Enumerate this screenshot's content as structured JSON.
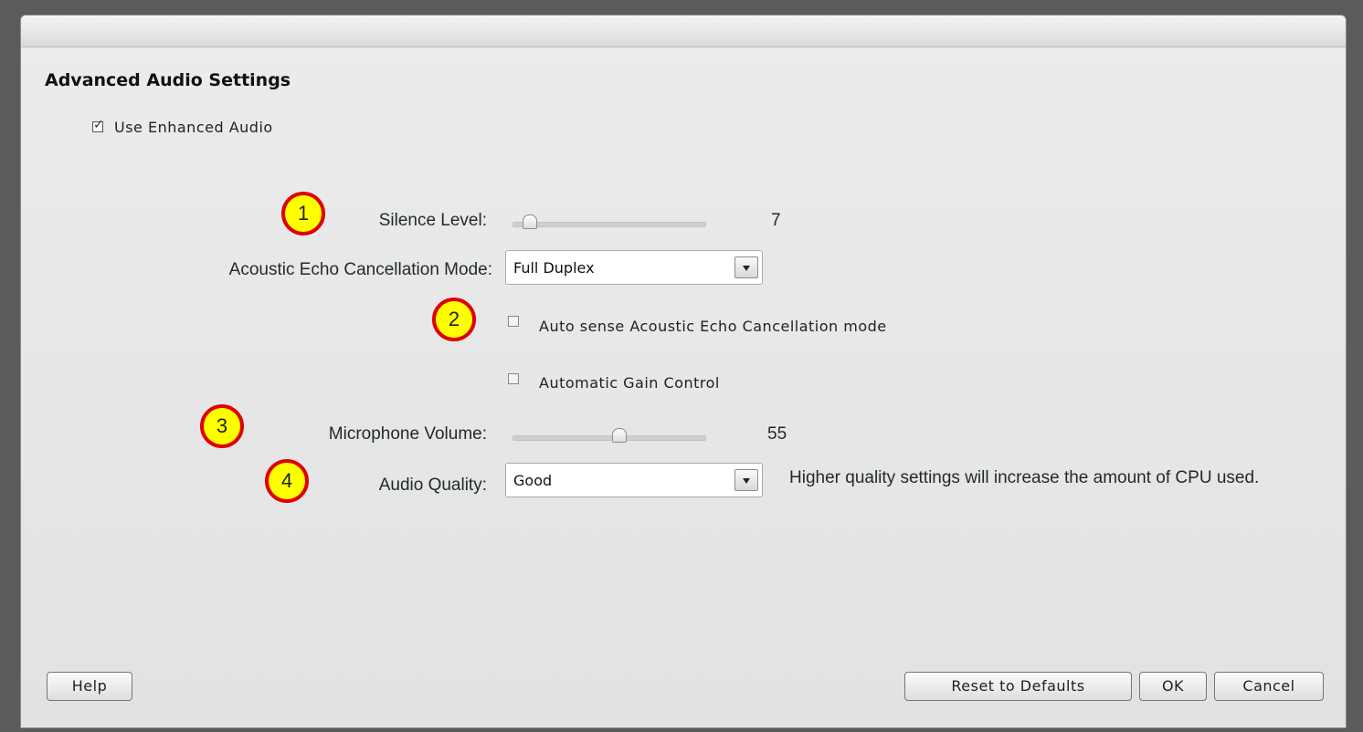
{
  "dialog": {
    "heading": "Advanced Audio Settings"
  },
  "enhanced_audio": {
    "label": "Use Enhanced Audio",
    "checked": true
  },
  "silence_level": {
    "label": "Silence Level:",
    "value": "7",
    "fraction": 0.05
  },
  "aec_mode": {
    "label": "Acoustic Echo Cancellation Mode:",
    "selected": "Full Duplex"
  },
  "auto_sense": {
    "label": "Auto sense Acoustic Echo Cancellation mode",
    "checked": false
  },
  "auto_gain": {
    "label": "Automatic Gain Control",
    "checked": false
  },
  "mic_volume": {
    "label": "Microphone Volume:",
    "value": "55",
    "fraction": 0.55
  },
  "audio_quality": {
    "label": "Audio Quality:",
    "selected": "Good",
    "note": "Higher quality settings will increase the amount of CPU used."
  },
  "badges": [
    "1",
    "2",
    "3",
    "4"
  ],
  "buttons": {
    "help": "Help",
    "reset": "Reset to Defaults",
    "ok": "OK",
    "cancel": "Cancel"
  },
  "colors": {
    "badge_fill": "#ffff00",
    "badge_border": "#e00000"
  }
}
